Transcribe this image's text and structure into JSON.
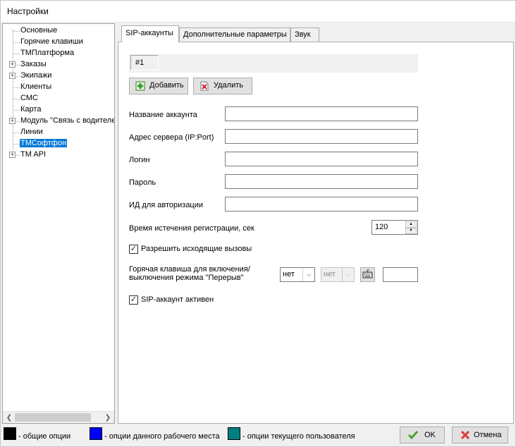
{
  "window": {
    "title": "Настройки"
  },
  "tree": {
    "items": [
      {
        "label": "Основные",
        "expandable": false,
        "selected": false
      },
      {
        "label": "Горячие клавиши",
        "expandable": false,
        "selected": false
      },
      {
        "label": "ТМПлатформа",
        "expandable": false,
        "selected": false
      },
      {
        "label": "Заказы",
        "expandable": true,
        "selected": false
      },
      {
        "label": "Экипажи",
        "expandable": true,
        "selected": false
      },
      {
        "label": "Клиенты",
        "expandable": false,
        "selected": false
      },
      {
        "label": "СМС",
        "expandable": false,
        "selected": false
      },
      {
        "label": "Карта",
        "expandable": false,
        "selected": false
      },
      {
        "label": "Модуль \"Связь с водителем\"",
        "expandable": true,
        "selected": false
      },
      {
        "label": "Линии",
        "expandable": false,
        "selected": false
      },
      {
        "label": "ТМСофтфон",
        "expandable": false,
        "selected": true
      },
      {
        "label": "TM API",
        "expandable": true,
        "selected": false
      }
    ]
  },
  "tabs": [
    {
      "label": "SIP-аккаунты",
      "active": true
    },
    {
      "label": "Дополнительные параметры",
      "active": false
    },
    {
      "label": "Звук",
      "active": false
    }
  ],
  "sip": {
    "account_chip": "#1",
    "add_label": "Добавить",
    "delete_label": "Удалить",
    "fields": {
      "account_name": {
        "label": "Название аккаунта",
        "value": ""
      },
      "server_address": {
        "label": "Адрес сервера (IP:Port)",
        "value": ""
      },
      "login": {
        "label": "Логин",
        "value": ""
      },
      "password": {
        "label": "Пароль",
        "value": ""
      },
      "auth_id": {
        "label": "ИД для авторизации",
        "value": ""
      }
    },
    "expiry": {
      "label": "Время истечения регистрации, сек",
      "value": "120"
    },
    "allow_outgoing": {
      "label": "Разрешить исходящие вызовы",
      "checked": true
    },
    "hotkey": {
      "label_line1": "Горячая клавиша для  включения/",
      "label_line2": "выключения режима \"Перерыв\"",
      "modifier1": "нет",
      "modifier2": "нет",
      "key_value": ""
    },
    "account_active": {
      "label": "SIP-аккаунт активен",
      "checked": true
    }
  },
  "footer": {
    "legend": [
      {
        "color": "#000000",
        "label": "- общие опции"
      },
      {
        "color": "#0000ff",
        "label": "- опции данного рабочего места"
      },
      {
        "color": "#008080",
        "label": "- опции текущего пользователя"
      }
    ],
    "ok_label": "OK",
    "cancel_label": "Отмена"
  }
}
